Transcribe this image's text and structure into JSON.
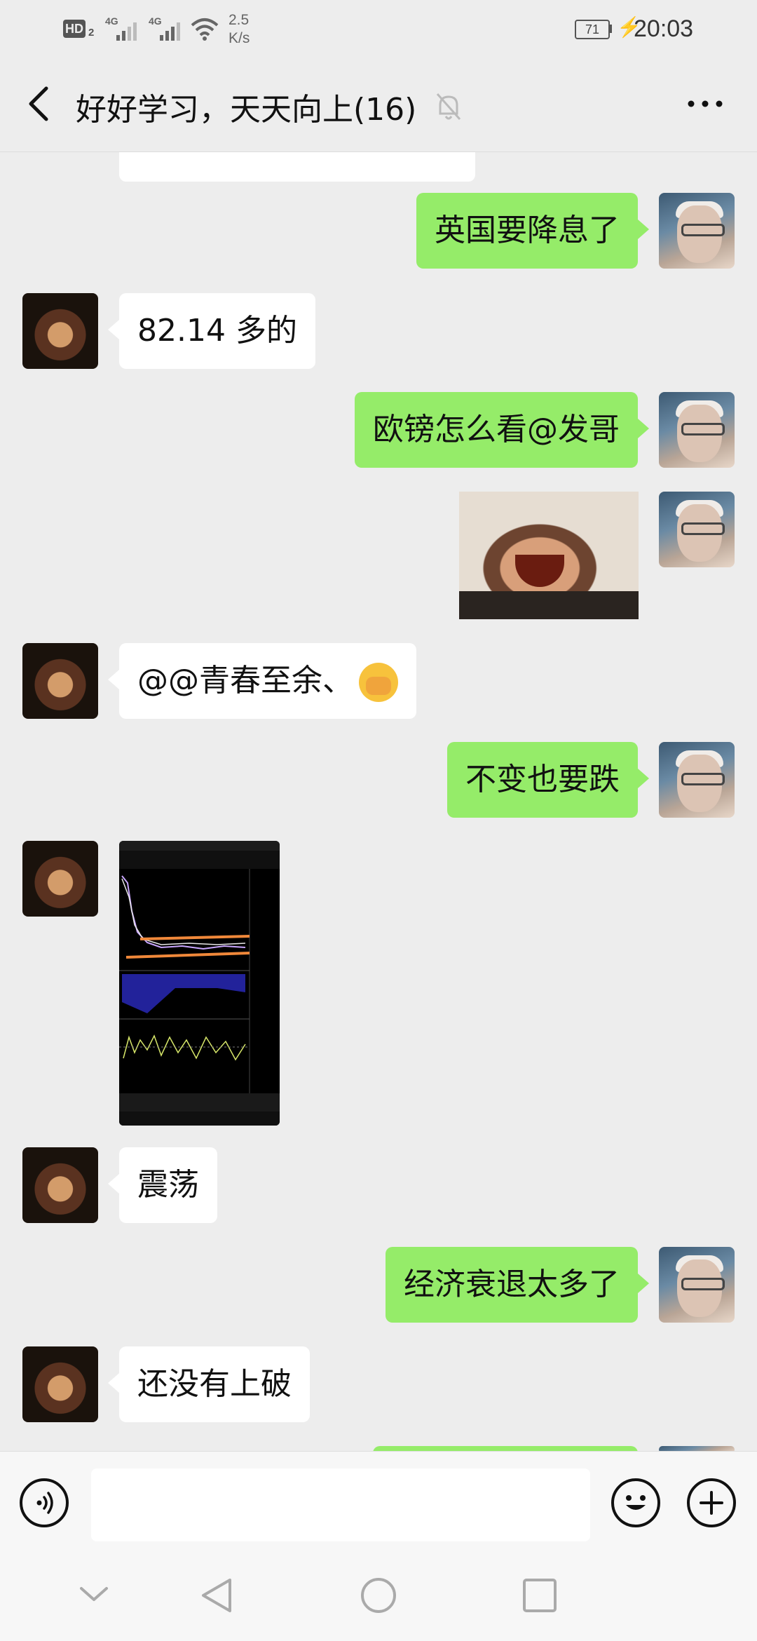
{
  "status_bar": {
    "hd_label": "HD",
    "hd_sub": "2",
    "network_1": "4G",
    "network_2": "4G",
    "speed_value": "2.5",
    "speed_unit": "K/s",
    "battery": "71",
    "time": "20:03"
  },
  "header": {
    "title": "好好学习，天天向上(16)"
  },
  "messages": [
    {
      "side": "right",
      "type": "text",
      "text": "英国要降息了"
    },
    {
      "side": "left",
      "type": "text",
      "text": "82.14 多的"
    },
    {
      "side": "right",
      "type": "text",
      "text": "欧镑怎么看@发哥"
    },
    {
      "side": "right",
      "type": "image",
      "description": "photo"
    },
    {
      "side": "left",
      "type": "text",
      "text": "@@青春至余、"
    },
    {
      "side": "right",
      "type": "text",
      "text": "不变也要跌"
    },
    {
      "side": "left",
      "type": "image",
      "description": "screenshot"
    },
    {
      "side": "left",
      "type": "text",
      "text": "震荡"
    },
    {
      "side": "right",
      "type": "text",
      "text": "经济衰退太多了"
    },
    {
      "side": "left",
      "type": "text",
      "text": "还没有上破"
    }
  ],
  "input_bar": {
    "placeholder": ""
  },
  "colors": {
    "background": "#ededed",
    "my_bubble": "#95ec69",
    "other_bubble": "#ffffff"
  },
  "icons": {
    "back": "chevron-left-icon",
    "mute": "bell-off-icon",
    "more": "more-dots-icon",
    "voice": "voice-icon",
    "emoji": "emoji-icon",
    "plus": "plus-icon",
    "nav_down": "chevron-down-icon",
    "nav_back": "triangle-back-icon",
    "nav_home": "circle-home-icon",
    "nav_recent": "square-recent-icon"
  }
}
